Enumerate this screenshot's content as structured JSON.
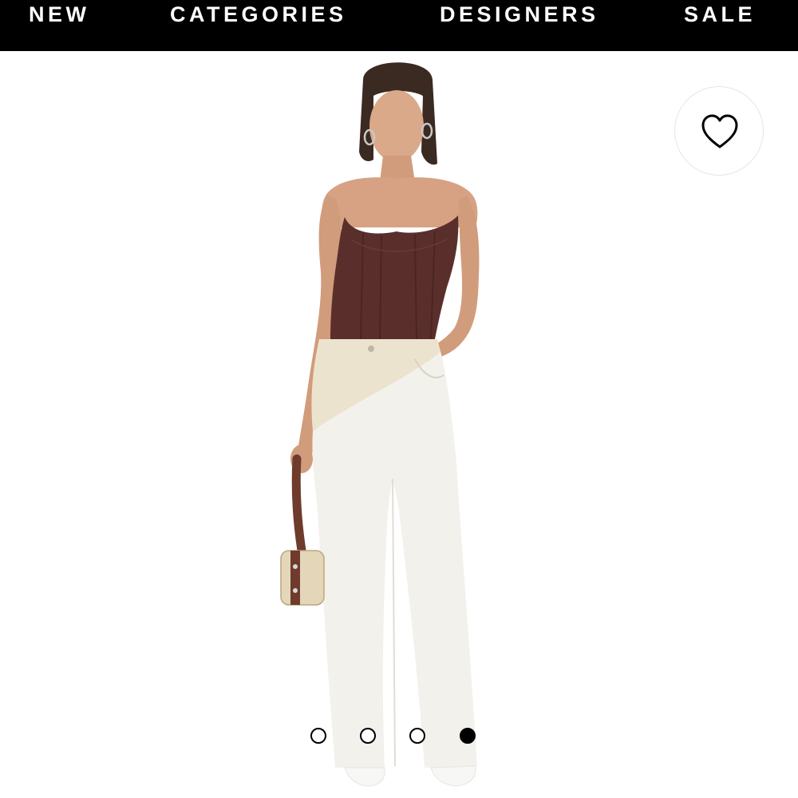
{
  "nav": {
    "items": [
      {
        "label": "NEW"
      },
      {
        "label": "CATEGORIES"
      },
      {
        "label": "DESIGNERS"
      },
      {
        "label": "SALE"
      }
    ]
  },
  "product": {
    "image_subject": "model-wearing-brown-leather-corset-and-white-jeans",
    "wishlist_icon": "heart-outline-icon"
  },
  "carousel": {
    "total": 4,
    "active_index": 4
  },
  "colors": {
    "nav_background": "#000000",
    "nav_text": "#ffffff",
    "corset": "#5a2f2b",
    "jeans": "#f3f1ec",
    "denim_panel": "#ece3cf"
  }
}
